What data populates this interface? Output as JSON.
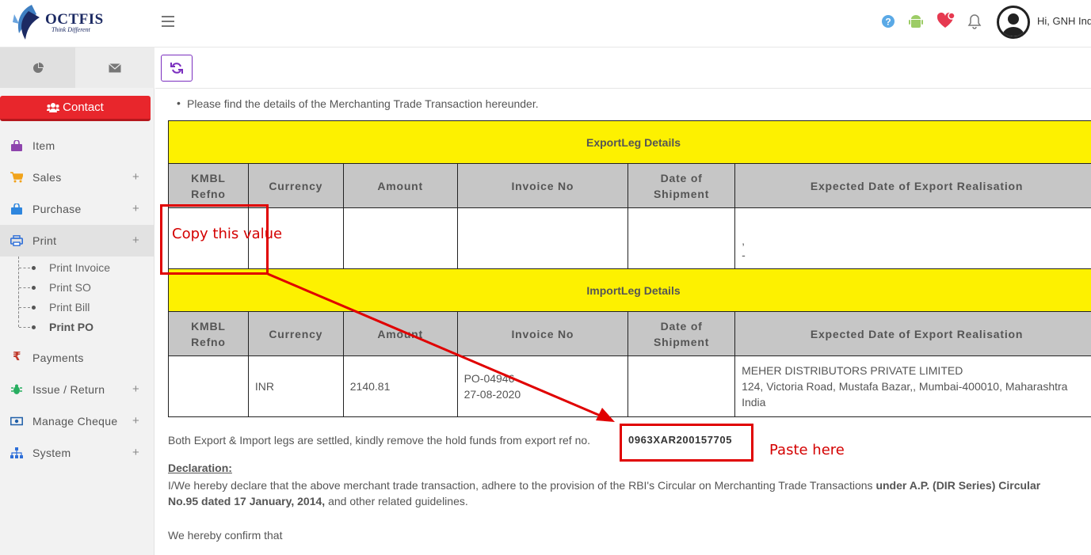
{
  "brand": {
    "name": "OCTFIS",
    "tagline": "Think Different"
  },
  "header": {
    "greeting": "Hi, GNH Ind"
  },
  "sidebar": {
    "contact_label": "Contact",
    "items": [
      {
        "label": "Item",
        "plus": ""
      },
      {
        "label": "Sales",
        "plus": "+"
      },
      {
        "label": "Purchase",
        "plus": "+"
      },
      {
        "label": "Print",
        "plus": "+"
      },
      {
        "label": "Payments",
        "plus": ""
      },
      {
        "label": "Issue / Return",
        "plus": "+"
      },
      {
        "label": "Manage Cheque",
        "plus": "+"
      },
      {
        "label": "System",
        "plus": "+"
      }
    ],
    "print_sub": [
      "Print Invoice",
      "Print SO",
      "Print Bill",
      "Print PO"
    ]
  },
  "content": {
    "bullet": "Please find the details of the Merchanting Trade Transaction hereunder.",
    "export_title": "ExportLeg Details",
    "import_title": "ImportLeg Details",
    "columns": {
      "refno_1": "KMBL",
      "refno_2": "Refno",
      "currency": "Currency",
      "amount": "Amount",
      "invoice": "Invoice No",
      "date_1": "Date of",
      "date_2": "Shipment",
      "expected": "Expected Date of Export Realisation"
    },
    "export_row": {
      "refno": "",
      "currency": "",
      "amount": "",
      "invoice": "",
      "date": "",
      "expected_1": ",",
      "expected_2": "-"
    },
    "import_row": {
      "refno": "",
      "currency": "INR",
      "amount": "2140.81",
      "invoice_1": "PO-04946",
      "invoice_2": "27-08-2020",
      "date": "",
      "addr_1": "MEHER DISTRIBUTORS PRIVATE LIMITED",
      "addr_2": "124, Victoria Road, Mustafa Bazar,, Mumbai-400010, Maharashtra",
      "addr_3": "India"
    },
    "settled_text": "Both Export & Import legs are settled, kindly remove the hold funds from export ref no.",
    "export_ref": "0963XAR200157705",
    "declaration_title": "Declaration:",
    "declaration_1": "I/We hereby declare that the above merchant trade transaction, adhere to the provision of the RBI's Circular on Merchanting Trade Transactions ",
    "declaration_bold_1": "under A.P. (DIR Series) Circular",
    "declaration_bold_2": "No.95 dated 17 January, 2014,",
    "declaration_2": " and other related guidelines.",
    "confirm": "We hereby confirm that"
  },
  "annotations": {
    "copy_label": "Copy this value",
    "paste_label": "Paste here",
    "color": "#e00000"
  },
  "colors": {
    "section_yellow": "#fdf100",
    "header_gray": "#c6c6c6",
    "contact_red": "#e8262c",
    "accent_purple": "#7b2fbf"
  }
}
